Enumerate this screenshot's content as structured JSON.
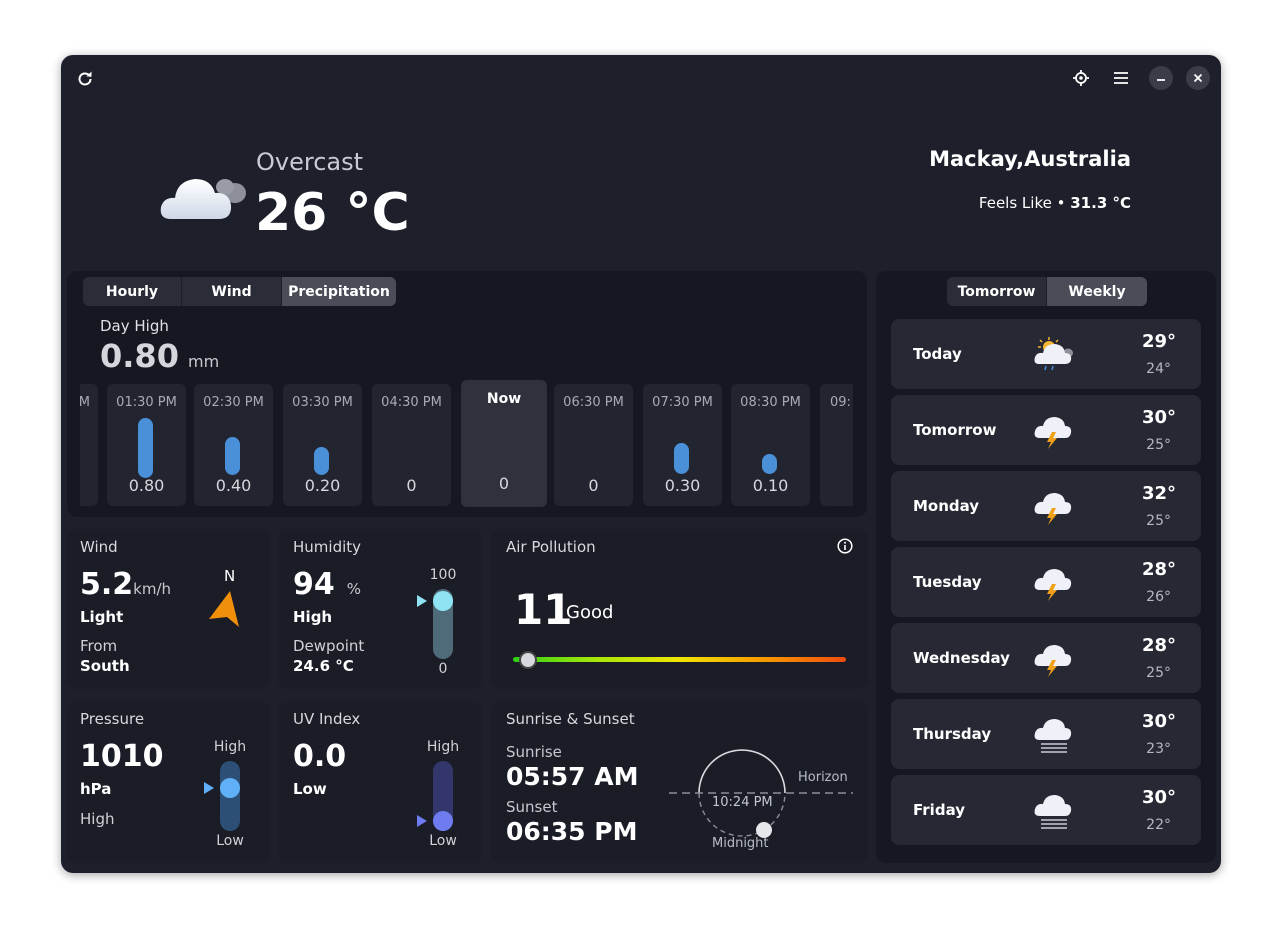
{
  "header": {
    "refresh_icon": "refresh-icon",
    "locate_icon": "crosshair-icon",
    "menu_icon": "hamburger-icon",
    "minimize_icon": "minimize-icon",
    "close_icon": "close-icon"
  },
  "current": {
    "condition": "Overcast",
    "temperature": "26 °C",
    "location": "Mackay,Australia",
    "feels_like_label": "Feels Like •",
    "feels_like_value": "31.3 °C"
  },
  "forecast_tabs": [
    "Hourly",
    "Wind",
    "Precipitation"
  ],
  "precip": {
    "label": "Day High",
    "value": "0.80",
    "unit": "mm",
    "partial_left": "M",
    "partial_right": "09:",
    "hours": [
      {
        "time": "01:30 PM",
        "value": "0.80",
        "amount": 0.8
      },
      {
        "time": "02:30 PM",
        "value": "0.40",
        "amount": 0.4
      },
      {
        "time": "03:30 PM",
        "value": "0.20",
        "amount": 0.2
      },
      {
        "time": "04:30 PM",
        "value": "0",
        "amount": 0
      },
      {
        "time": "Now",
        "value": "0",
        "amount": 0
      },
      {
        "time": "06:30 PM",
        "value": "0",
        "amount": 0
      },
      {
        "time": "07:30 PM",
        "value": "0.30",
        "amount": 0.3
      },
      {
        "time": "08:30 PM",
        "value": "0.10",
        "amount": 0.1
      }
    ]
  },
  "wind": {
    "title": "Wind",
    "speed": "5.2",
    "unit": "km/h",
    "desc": "Light",
    "from_label": "From",
    "from_value": "South",
    "compass": "N"
  },
  "humidity": {
    "title": "Humidity",
    "value": "94",
    "unit": "%",
    "level": "High",
    "dewpoint_label": "Dewpoint",
    "dewpoint_value": "24.6 °C",
    "scale_max": "100",
    "scale_min": "0"
  },
  "air": {
    "title": "Air Pollution",
    "value": "11",
    "label": "Good"
  },
  "pressure": {
    "title": "Pressure",
    "value": "1010",
    "unit": "hPa",
    "level": "High",
    "scale_high": "High",
    "scale_low": "Low"
  },
  "uv": {
    "title": "UV Index",
    "value": "0.0",
    "level": "Low",
    "scale_high": "High",
    "scale_low": "Low"
  },
  "sun": {
    "title": "Sunrise & Sunset",
    "sunrise_label": "Sunrise",
    "sunrise": "05:57 AM",
    "sunset_label": "Sunset",
    "sunset": "06:35 PM",
    "horizon": "Horizon",
    "time_now": "10:24 PM",
    "midnight": "Midnight"
  },
  "daily_tabs": [
    "Tomorrow",
    "Weekly"
  ],
  "daily": [
    {
      "day": "Today",
      "hi": "29°",
      "lo": "24°",
      "icon": "partly-cloudy-rain-icon"
    },
    {
      "day": "Tomorrow",
      "hi": "30°",
      "lo": "25°",
      "icon": "thunderstorm-icon"
    },
    {
      "day": "Monday",
      "hi": "32°",
      "lo": "25°",
      "icon": "thunderstorm-icon"
    },
    {
      "day": "Tuesday",
      "hi": "28°",
      "lo": "26°",
      "icon": "thunderstorm-icon"
    },
    {
      "day": "Wednesday",
      "hi": "28°",
      "lo": "25°",
      "icon": "thunderstorm-icon"
    },
    {
      "day": "Thursday",
      "hi": "30°",
      "lo": "23°",
      "icon": "fog-cloud-icon"
    },
    {
      "day": "Friday",
      "hi": "30°",
      "lo": "22°",
      "icon": "fog-cloud-icon"
    }
  ],
  "colors": {
    "bar": "#4a90d9",
    "compass_arrow": "#f0900a",
    "humidity_knob": "#8fe3f3",
    "uv_knob": "#6f7cf0"
  }
}
